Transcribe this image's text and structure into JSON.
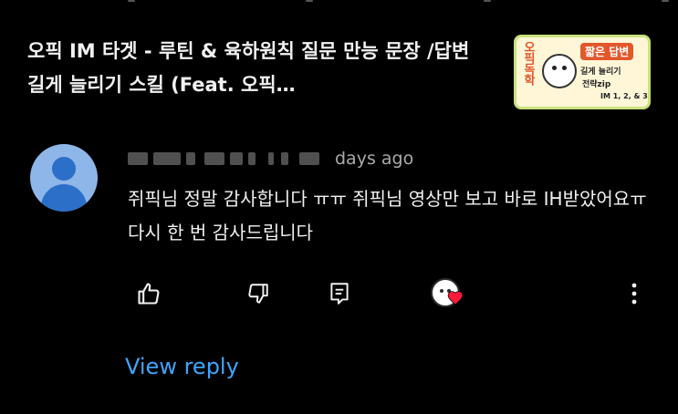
{
  "video": {
    "title": "오픽 IM 타겟 - 루틴 & 육하원칙 질문 만능 문장 /답변 길게 늘리기 스킬 (Feat. 오픽…",
    "thumbnail": {
      "side_label": "오픽독학",
      "badge": "짧은 답변",
      "line1": "길게 늘리기",
      "line2": "전략zip",
      "tag": "IM 1, 2, & 3",
      "bg_color": "#fff6d8",
      "border_color": "#c7e27a",
      "accent_color": "#e3572b"
    }
  },
  "comment": {
    "time": "days ago",
    "text": "쥐픽님 정말 감사합니다 ㅠㅠ 쥐픽님 영상만 보고 바로 IH받았어요ㅠ 다시 한 번 감사드립니다",
    "avatar_color": "#8fb6e8"
  },
  "actions": {
    "like_icon": "thumb-up-icon",
    "dislike_icon": "thumb-down-icon",
    "reply_icon": "reply-icon",
    "heart_icon": "creator-heart-icon",
    "more_icon": "more-vert-icon"
  },
  "view_reply": "View reply",
  "colors": {
    "background": "#000000",
    "text": "#f1f1f1",
    "muted": "#aaaaaa",
    "link": "#3ea6ff",
    "heart": "#ff1a3a"
  }
}
